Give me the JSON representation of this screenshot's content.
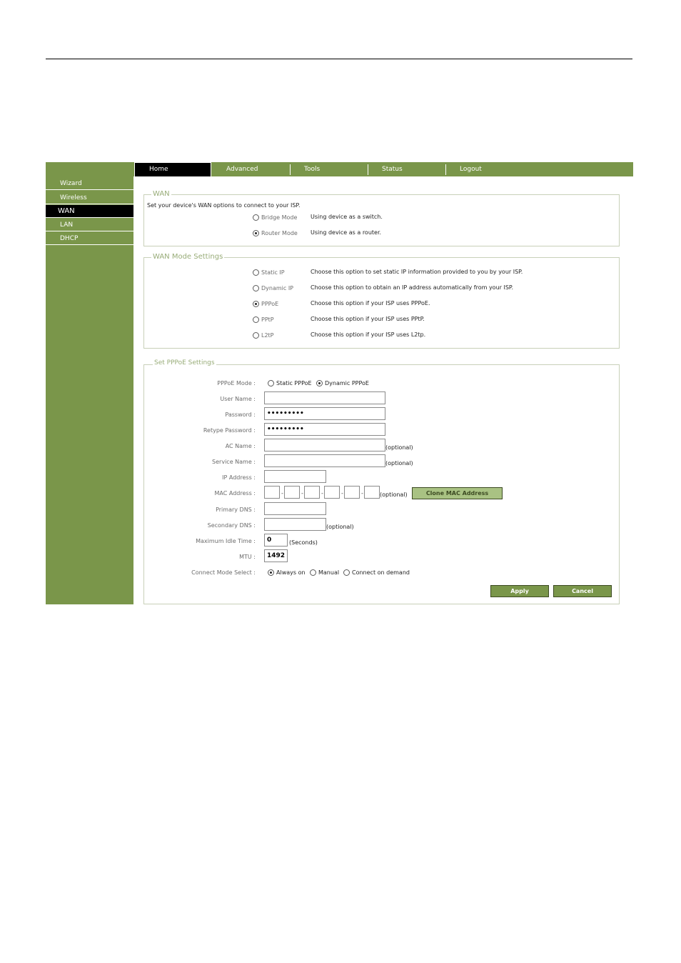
{
  "nav": {
    "tabs": [
      {
        "label": "Home"
      },
      {
        "label": "Advanced"
      },
      {
        "label": "Tools"
      },
      {
        "label": "Status"
      },
      {
        "label": "Logout"
      }
    ]
  },
  "sidebar": {
    "items": [
      {
        "label": "Wizard"
      },
      {
        "label": "Wireless"
      },
      {
        "label": "WAN"
      },
      {
        "label": "LAN"
      },
      {
        "label": "DHCP"
      }
    ]
  },
  "wan": {
    "legend": "WAN",
    "intro": "Set your device's WAN options to connect to your ISP.",
    "bridge_label": "Bridge Mode",
    "bridge_desc": "Using device as a switch.",
    "router_label": "Router Mode",
    "router_desc": "Using device as a router."
  },
  "wan_mode": {
    "legend": "WAN Mode Settings",
    "options": [
      {
        "label": "Static IP",
        "desc": "Choose this option to set static IP information provided to you by your ISP."
      },
      {
        "label": "Dynamic IP",
        "desc": "Choose this option to obtain an IP address automatically from your ISP."
      },
      {
        "label": "PPPoE",
        "desc": "Choose this option if your ISP uses PPPoE."
      },
      {
        "label": "PPtP",
        "desc": "Choose this option if your ISP uses PPtP."
      },
      {
        "label": "L2tP",
        "desc": "Choose this option if your ISP uses L2tp."
      }
    ]
  },
  "pppoe": {
    "legend": "Set PPPoE Settings",
    "mode_label": "PPPoE Mode :",
    "mode_static": "Static PPPoE",
    "mode_dynamic": "Dynamic PPPoE",
    "user_label": "User Name :",
    "user_value": "",
    "password_label": "Password :",
    "password_value": "•••••••••",
    "retype_label": "Retype Password :",
    "retype_value": "•••••••••",
    "ac_label": "AC Name :",
    "ac_value": "",
    "optional": "(optional)",
    "service_label": "Service Name :",
    "service_value": "",
    "ip_label": "IP Address :",
    "ip_value": "",
    "mac_label": "MAC Address :",
    "mac_sep": "-",
    "clone_button": "Clone MAC Address",
    "dns1_label": "Primary DNS :",
    "dns1_value": "",
    "dns2_label": "Secondary DNS :",
    "dns2_value": "",
    "idle_label": "Maximum Idle Time :",
    "idle_value": "0",
    "idle_unit": "(Seconds)",
    "mtu_label": "MTU :",
    "mtu_value": "1492",
    "connect_label": "Connect Mode Select :",
    "connect_always": "Always on",
    "connect_manual": "Manual",
    "connect_demand": "Connect on demand",
    "apply_button": "Apply",
    "cancel_button": "Cancel"
  }
}
